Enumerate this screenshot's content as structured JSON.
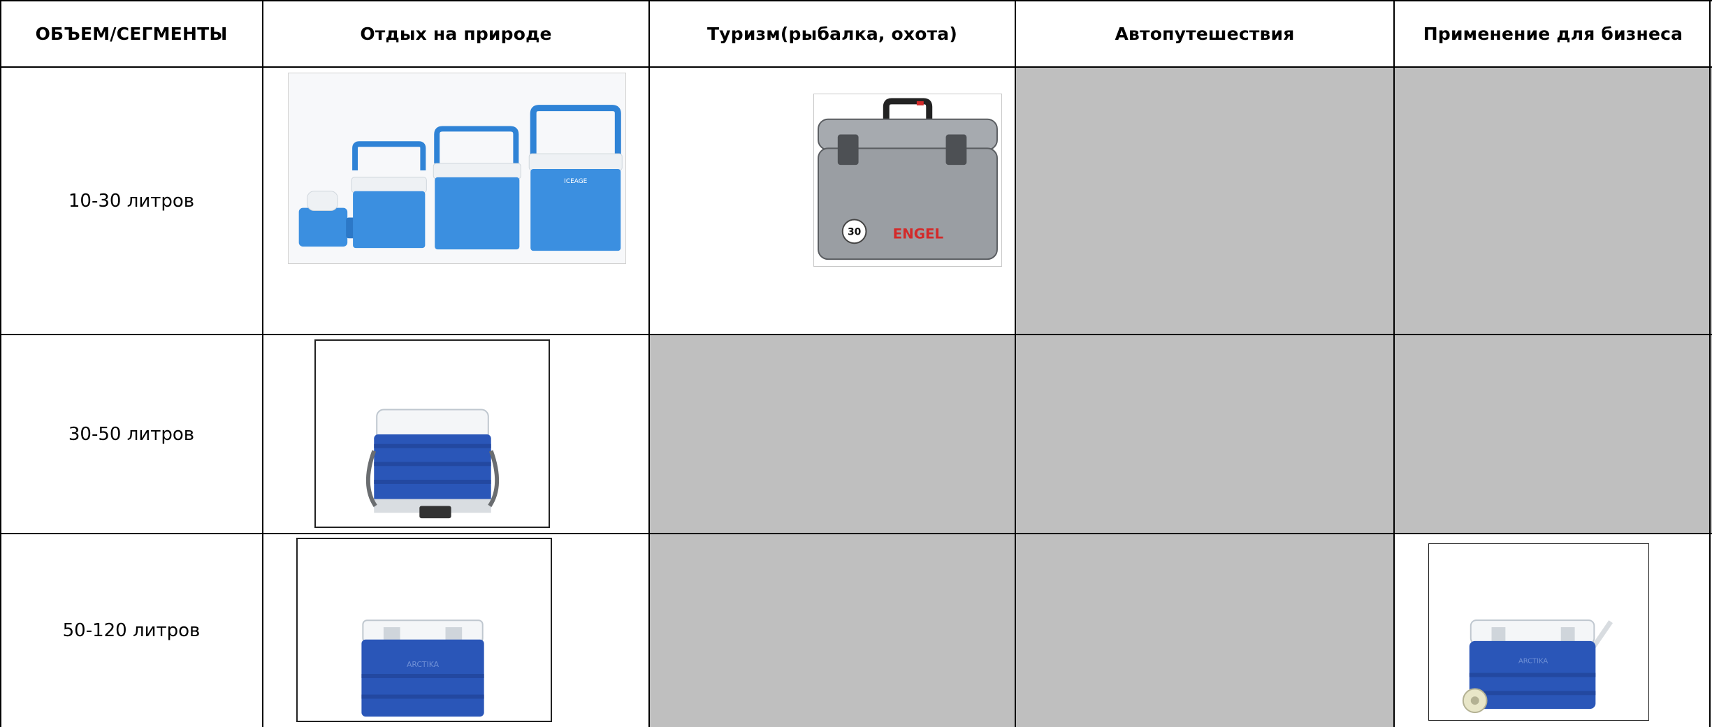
{
  "table": {
    "headers": [
      "ОБЪЕМ/СЕГМЕНТЫ",
      "Отдых на природе",
      "Туризм(рыбалка, охота)",
      "Автопутешествия",
      "Применение для бизнеса"
    ],
    "rows": [
      {
        "label": "10-30 литров"
      },
      {
        "label": "30-50 литров"
      },
      {
        "label": "50-120 литров"
      }
    ]
  },
  "products": {
    "cooler_set": {
      "brand_text": "ICEAGE"
    },
    "engel_box": {
      "brand_text": "ENGEL",
      "badge": "30"
    },
    "cooler_30_50": {
      "brand_text": ""
    },
    "cooler_50_120": {
      "brand_text": "ARCTIKA"
    },
    "cooler_wheeled": {
      "brand_text": "ARCTIKA"
    }
  },
  "colors": {
    "empty_cell": "#bfbfbf",
    "cooler_light_blue": "#3b8fe0",
    "cooler_dark_blue": "#2a56b8",
    "lid_white": "#f4f6f8",
    "engel_gray": "#9a9ea3",
    "engel_red": "#d32a2a"
  }
}
